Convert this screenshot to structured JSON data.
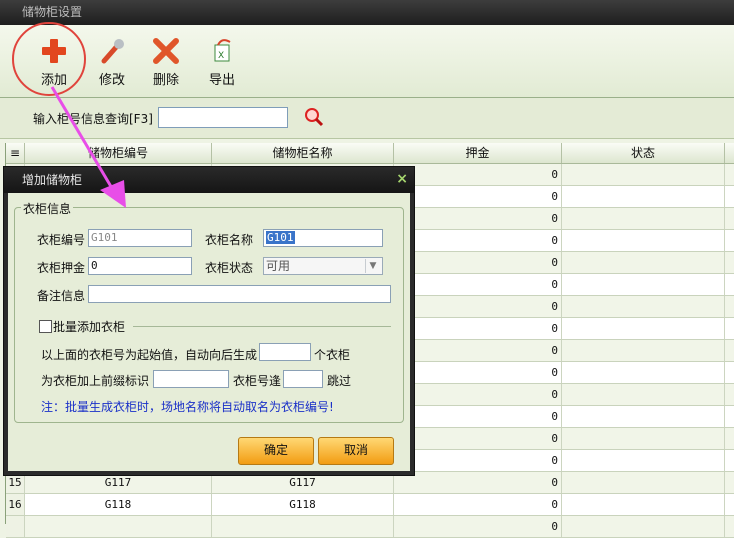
{
  "window": {
    "title": "储物柜设置"
  },
  "toolbar": {
    "add_label": "添加",
    "edit_label": "修改",
    "delete_label": "删除",
    "export_label": "导出"
  },
  "search": {
    "label": "输入柜号信息查询[F3]",
    "value": ""
  },
  "grid": {
    "headers": [
      "储物柜编号",
      "储物柜名称",
      "押金",
      "状态"
    ],
    "rows": [
      {
        "num": "",
        "code": "",
        "name": "",
        "deposit": "0",
        "status": ""
      },
      {
        "num": "",
        "code": "",
        "name": "",
        "deposit": "0",
        "status": ""
      },
      {
        "num": "",
        "code": "",
        "name": "",
        "deposit": "0",
        "status": ""
      },
      {
        "num": "",
        "code": "",
        "name": "",
        "deposit": "0",
        "status": ""
      },
      {
        "num": "",
        "code": "",
        "name": "",
        "deposit": "0",
        "status": ""
      },
      {
        "num": "",
        "code": "",
        "name": "",
        "deposit": "0",
        "status": ""
      },
      {
        "num": "",
        "code": "",
        "name": "",
        "deposit": "0",
        "status": ""
      },
      {
        "num": "",
        "code": "",
        "name": "",
        "deposit": "0",
        "status": ""
      },
      {
        "num": "",
        "code": "",
        "name": "",
        "deposit": "0",
        "status": ""
      },
      {
        "num": "",
        "code": "",
        "name": "",
        "deposit": "0",
        "status": ""
      },
      {
        "num": "",
        "code": "",
        "name": "",
        "deposit": "0",
        "status": ""
      },
      {
        "num": "",
        "code": "",
        "name": "",
        "deposit": "0",
        "status": ""
      },
      {
        "num": "",
        "code": "",
        "name": "",
        "deposit": "0",
        "status": ""
      },
      {
        "num": "",
        "code": "",
        "name": "",
        "deposit": "0",
        "status": ""
      },
      {
        "num": "15",
        "code": "G117",
        "name": "G117",
        "deposit": "0",
        "status": ""
      },
      {
        "num": "16",
        "code": "G118",
        "name": "G118",
        "deposit": "0",
        "status": ""
      },
      {
        "num": "",
        "code": "",
        "name": "",
        "deposit": "0",
        "status": ""
      }
    ]
  },
  "dialog": {
    "title": "增加储物柜",
    "close": "×",
    "group_label": "衣柜信息",
    "code_label": "衣柜编号",
    "code_value": "G101",
    "name_label": "衣柜名称",
    "name_value": "G101",
    "deposit_label": "衣柜押金",
    "deposit_value": "0",
    "status_label": "衣柜状态",
    "status_value": "可用",
    "remark_label": "备注信息",
    "remark_value": "",
    "batch_label": "批量添加衣柜",
    "batch_line1_a": "以上面的衣柜号为起始值，自动向后生成",
    "batch_line1_b": "个衣柜",
    "batch_line2_a": "为衣柜加上前缀标识",
    "batch_line2_b": "衣柜号逢",
    "batch_line2_c": "跳过",
    "note": "注：批量生成衣柜时，场地名称将自动取名为衣柜编号!",
    "ok": "确定",
    "cancel": "取消"
  },
  "colors": {
    "accent_ring": "#e0443c",
    "arrow": "#e84ee8",
    "note": "#1a30c8",
    "button": "#f29c12"
  }
}
